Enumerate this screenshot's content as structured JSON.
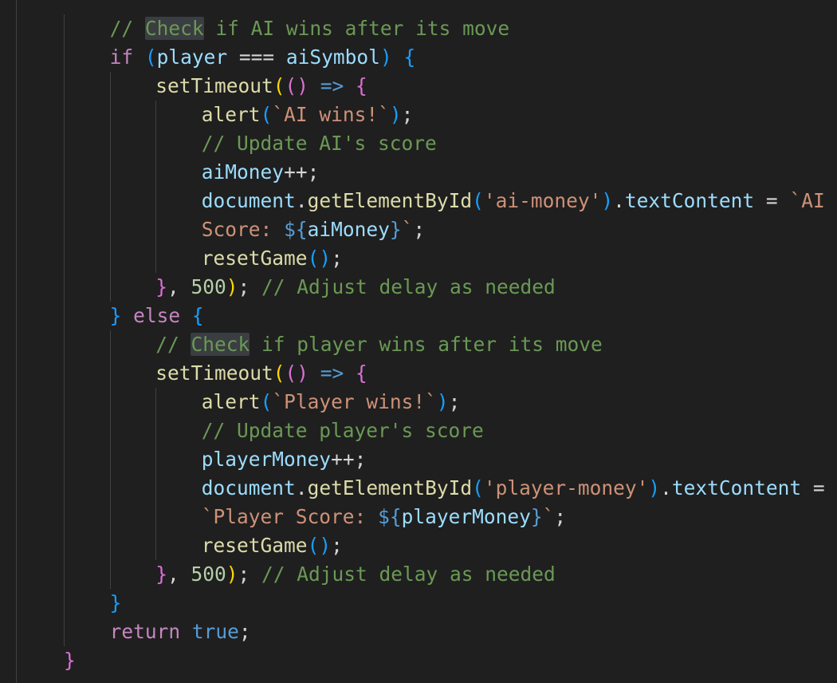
{
  "editor": {
    "lines": [
      {
        "indent": 1,
        "tokens": [
          {
            "t": "// ",
            "c": "comment"
          },
          {
            "t": "Check",
            "c": "comment",
            "h": true
          },
          {
            "t": " if AI wins after its move",
            "c": "comment"
          }
        ]
      },
      {
        "indent": 1,
        "tokens": [
          {
            "t": "if",
            "c": "keyword"
          },
          {
            "t": " ",
            "c": "op"
          },
          {
            "t": "(",
            "c": "bracket3"
          },
          {
            "t": "player",
            "c": "var"
          },
          {
            "t": " === ",
            "c": "op"
          },
          {
            "t": "aiSymbol",
            "c": "var"
          },
          {
            "t": ")",
            "c": "bracket3"
          },
          {
            "t": " ",
            "c": "op"
          },
          {
            "t": "{",
            "c": "bracket3"
          }
        ]
      },
      {
        "indent": 2,
        "tokens": [
          {
            "t": "setTimeout",
            "c": "func"
          },
          {
            "t": "(",
            "c": "bracket1"
          },
          {
            "t": "()",
            "c": "bracket2"
          },
          {
            "t": " ",
            "c": "op"
          },
          {
            "t": "=>",
            "c": "bool"
          },
          {
            "t": " ",
            "c": "op"
          },
          {
            "t": "{",
            "c": "bracket2"
          }
        ]
      },
      {
        "indent": 3,
        "tokens": [
          {
            "t": "alert",
            "c": "func"
          },
          {
            "t": "(",
            "c": "bracket3"
          },
          {
            "t": "`AI wins!`",
            "c": "string"
          },
          {
            "t": ")",
            "c": "bracket3"
          },
          {
            "t": ";",
            "c": "op"
          }
        ]
      },
      {
        "indent": 3,
        "tokens": [
          {
            "t": "// Update AI's score",
            "c": "comment"
          }
        ]
      },
      {
        "indent": 3,
        "tokens": [
          {
            "t": "aiMoney",
            "c": "var"
          },
          {
            "t": "++;",
            "c": "op"
          }
        ]
      },
      {
        "indent": 3,
        "tokens": [
          {
            "t": "document",
            "c": "var"
          },
          {
            "t": ".",
            "c": "op"
          },
          {
            "t": "getElementById",
            "c": "func"
          },
          {
            "t": "(",
            "c": "bracket3"
          },
          {
            "t": "'ai-money'",
            "c": "string"
          },
          {
            "t": ")",
            "c": "bracket3"
          },
          {
            "t": ".",
            "c": "op"
          },
          {
            "t": "textContent",
            "c": "var"
          },
          {
            "t": " = ",
            "c": "op"
          },
          {
            "t": "`AI",
            "c": "string"
          }
        ]
      },
      {
        "indent": 3,
        "tokens": [
          {
            "t": "Score: ",
            "c": "string"
          },
          {
            "t": "${",
            "c": "bool"
          },
          {
            "t": "aiMoney",
            "c": "var"
          },
          {
            "t": "}",
            "c": "bool"
          },
          {
            "t": "`",
            "c": "string"
          },
          {
            "t": ";",
            "c": "op"
          }
        ]
      },
      {
        "indent": 3,
        "tokens": [
          {
            "t": "resetGame",
            "c": "func"
          },
          {
            "t": "()",
            "c": "bracket3"
          },
          {
            "t": ";",
            "c": "op"
          }
        ]
      },
      {
        "indent": 2,
        "tokens": [
          {
            "t": "}",
            "c": "bracket2"
          },
          {
            "t": ", ",
            "c": "op"
          },
          {
            "t": "500",
            "c": "number"
          },
          {
            "t": ")",
            "c": "bracket1"
          },
          {
            "t": "; ",
            "c": "op"
          },
          {
            "t": "// Adjust delay as needed",
            "c": "comment"
          }
        ]
      },
      {
        "indent": 1,
        "tokens": [
          {
            "t": "}",
            "c": "bracket3"
          },
          {
            "t": " ",
            "c": "op"
          },
          {
            "t": "else",
            "c": "keyword"
          },
          {
            "t": " ",
            "c": "op"
          },
          {
            "t": "{",
            "c": "bracket3"
          }
        ]
      },
      {
        "indent": 2,
        "tokens": [
          {
            "t": "// ",
            "c": "comment"
          },
          {
            "t": "Check",
            "c": "comment",
            "h": true
          },
          {
            "t": " if player wins after its move",
            "c": "comment"
          }
        ]
      },
      {
        "indent": 2,
        "tokens": [
          {
            "t": "setTimeout",
            "c": "func"
          },
          {
            "t": "(",
            "c": "bracket1"
          },
          {
            "t": "()",
            "c": "bracket2"
          },
          {
            "t": " ",
            "c": "op"
          },
          {
            "t": "=>",
            "c": "bool"
          },
          {
            "t": " ",
            "c": "op"
          },
          {
            "t": "{",
            "c": "bracket2"
          }
        ]
      },
      {
        "indent": 3,
        "tokens": [
          {
            "t": "alert",
            "c": "func"
          },
          {
            "t": "(",
            "c": "bracket3"
          },
          {
            "t": "`Player wins!`",
            "c": "string"
          },
          {
            "t": ")",
            "c": "bracket3"
          },
          {
            "t": ";",
            "c": "op"
          }
        ]
      },
      {
        "indent": 3,
        "tokens": [
          {
            "t": "// Update player's score",
            "c": "comment"
          }
        ]
      },
      {
        "indent": 3,
        "tokens": [
          {
            "t": "playerMoney",
            "c": "var"
          },
          {
            "t": "++;",
            "c": "op"
          }
        ]
      },
      {
        "indent": 3,
        "tokens": [
          {
            "t": "document",
            "c": "var"
          },
          {
            "t": ".",
            "c": "op"
          },
          {
            "t": "getElementById",
            "c": "func"
          },
          {
            "t": "(",
            "c": "bracket3"
          },
          {
            "t": "'player-money'",
            "c": "string"
          },
          {
            "t": ")",
            "c": "bracket3"
          },
          {
            "t": ".",
            "c": "op"
          },
          {
            "t": "textContent",
            "c": "var"
          },
          {
            "t": " =",
            "c": "op"
          }
        ]
      },
      {
        "indent": 3,
        "tokens": [
          {
            "t": "`Player Score: ",
            "c": "string"
          },
          {
            "t": "${",
            "c": "bool"
          },
          {
            "t": "playerMoney",
            "c": "var"
          },
          {
            "t": "}",
            "c": "bool"
          },
          {
            "t": "`",
            "c": "string"
          },
          {
            "t": ";",
            "c": "op"
          }
        ]
      },
      {
        "indent": 3,
        "tokens": [
          {
            "t": "resetGame",
            "c": "func"
          },
          {
            "t": "()",
            "c": "bracket3"
          },
          {
            "t": ";",
            "c": "op"
          }
        ]
      },
      {
        "indent": 2,
        "tokens": [
          {
            "t": "}",
            "c": "bracket2"
          },
          {
            "t": ", ",
            "c": "op"
          },
          {
            "t": "500",
            "c": "number"
          },
          {
            "t": ")",
            "c": "bracket1"
          },
          {
            "t": "; ",
            "c": "op"
          },
          {
            "t": "// Adjust delay as needed",
            "c": "comment"
          }
        ]
      },
      {
        "indent": 1,
        "tokens": [
          {
            "t": "}",
            "c": "bracket3"
          }
        ]
      },
      {
        "indent": 1,
        "tokens": [
          {
            "t": "return",
            "c": "keyword"
          },
          {
            "t": " ",
            "c": "op"
          },
          {
            "t": "true",
            "c": "bool"
          },
          {
            "t": ";",
            "c": "op"
          }
        ]
      },
      {
        "indent": 0,
        "tokens": [
          {
            "t": "}",
            "c": "bracket2"
          }
        ]
      }
    ]
  }
}
